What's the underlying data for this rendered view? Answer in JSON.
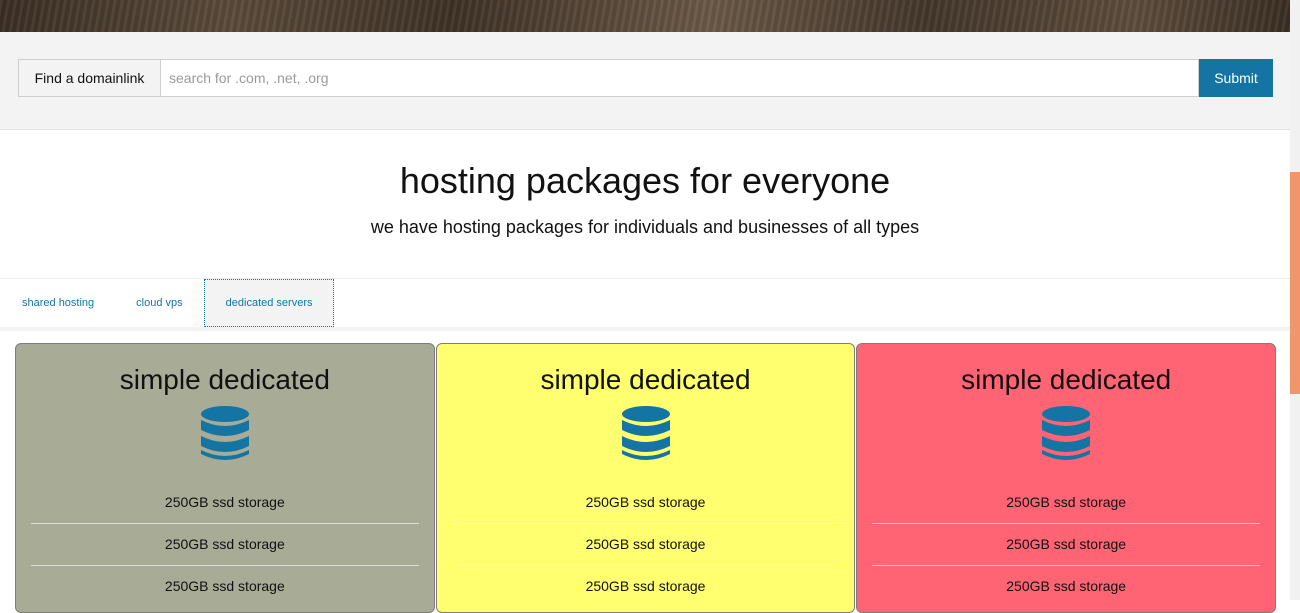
{
  "domain_search": {
    "label": "Find a domainlink",
    "placeholder": "search for .com, .net, .org",
    "value": "",
    "submit_label": "Submit"
  },
  "section": {
    "title": "hosting packages for everyone",
    "subtitle": "we have hosting packages for individuals and businesses of all types"
  },
  "tabs": [
    {
      "label": "shared hosting",
      "active": false
    },
    {
      "label": "cloud vps",
      "active": false
    },
    {
      "label": "dedicated servers",
      "active": true
    }
  ],
  "cards": [
    {
      "title": "simple dedicated",
      "icon": "database-icon",
      "bg_color": "#a8ab96",
      "icon_color": "#1474a4",
      "features": [
        "250GB ssd storage",
        "250GB ssd storage",
        "250GB ssd storage"
      ]
    },
    {
      "title": "simple dedicated",
      "icon": "database-icon",
      "bg_color": "#ffff70",
      "icon_color": "#1474a4",
      "features": [
        "250GB ssd storage",
        "250GB ssd storage",
        "250GB ssd storage"
      ]
    },
    {
      "title": "simple dedicated",
      "icon": "database-icon",
      "bg_color": "#ff6474",
      "icon_color": "#1474a4",
      "features": [
        "250GB ssd storage",
        "250GB ssd storage",
        "250GB ssd storage"
      ]
    }
  ],
  "colors": {
    "accent": "#1474a4",
    "scrollbar_thumb": "#f0956c"
  }
}
